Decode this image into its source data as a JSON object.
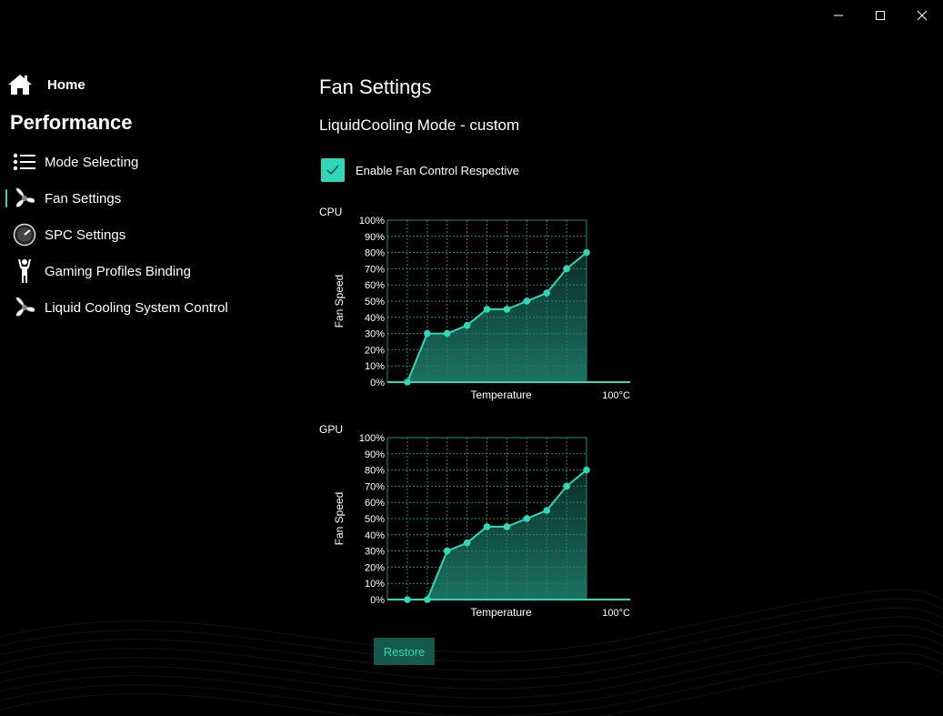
{
  "window": {
    "controls": [
      {
        "name": "minimize-button",
        "icon": "minimize-icon"
      },
      {
        "name": "maximize-button",
        "icon": "maximize-icon"
      },
      {
        "name": "close-button",
        "icon": "close-icon"
      }
    ]
  },
  "sidebar": {
    "home_label": "Home",
    "section_title": "Performance",
    "items": [
      {
        "label": "Mode Selecting",
        "icon": "list-icon",
        "selected": false
      },
      {
        "label": "Fan Settings",
        "icon": "fan-icon",
        "selected": true
      },
      {
        "label": "SPC Settings",
        "icon": "gauge-icon",
        "selected": false
      },
      {
        "label": "Gaming Profiles Binding",
        "icon": "person-icon",
        "selected": false
      },
      {
        "label": "Liquid Cooling System Control",
        "icon": "fan-icon",
        "selected": false
      }
    ]
  },
  "main": {
    "title": "Fan Settings",
    "mode_text": "LiquidCooling Mode - custom",
    "enable_checkbox": {
      "label": "Enable Fan Control Respective",
      "checked": true
    },
    "restore_label": "Restore"
  },
  "colors": {
    "accent": "#2ed9b8",
    "grid": "#1f8f79",
    "fill_top": "#1f7f6c",
    "restore_bg": "#145a4c"
  },
  "chart_data": [
    {
      "type": "line",
      "title": "CPU",
      "xlabel": "Temperature",
      "ylabel": "Fan Speed",
      "x_end_label": "100°C",
      "y_tick_labels": [
        "0%",
        "10%",
        "20%",
        "30%",
        "40%",
        "50%",
        "60%",
        "70%",
        "80%",
        "90%",
        "100%"
      ],
      "ylim": [
        0,
        100
      ],
      "grid": true,
      "values": [
        0,
        30,
        30,
        35,
        45,
        45,
        50,
        55,
        70,
        80
      ]
    },
    {
      "type": "line",
      "title": "GPU",
      "xlabel": "Temperature",
      "ylabel": "Fan Speed",
      "x_end_label": "100°C",
      "y_tick_labels": [
        "0%",
        "10%",
        "20%",
        "30%",
        "40%",
        "50%",
        "60%",
        "70%",
        "80%",
        "90%",
        "100%"
      ],
      "ylim": [
        0,
        100
      ],
      "grid": true,
      "values": [
        0,
        0,
        30,
        35,
        45,
        45,
        50,
        55,
        70,
        80
      ]
    }
  ]
}
